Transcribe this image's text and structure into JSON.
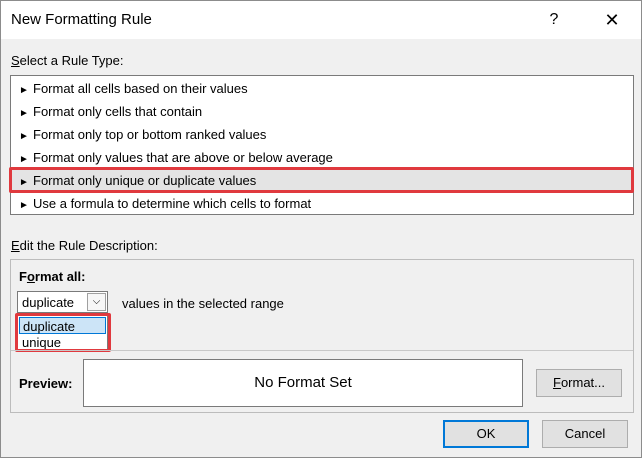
{
  "dialog": {
    "title": "New Formatting Rule",
    "help_label": "?",
    "close_label": "✕"
  },
  "rule_type": {
    "label_accel": "S",
    "label_rest": "elect a Rule Type:",
    "items": [
      "Format all cells based on their values",
      "Format only cells that contain",
      "Format only top or bottom ranked values",
      "Format only values that are above or below average",
      "Format only unique or duplicate values",
      "Use a formula to determine which cells to format"
    ],
    "selected_index": 4,
    "arrow_glyph": "►"
  },
  "description": {
    "label_accel": "E",
    "label_rest": "dit the Rule Description:",
    "format_all_accel": "o",
    "format_all_pre": "F",
    "format_all_post": "rmat all:",
    "combo_value": "duplicate",
    "combo_suffix": "values in the selected range",
    "options": [
      "duplicate",
      "unique"
    ],
    "highlight_color": "#e0393e"
  },
  "preview": {
    "label": "Preview:",
    "text": "No Format Set",
    "format_button_accel": "F",
    "format_button_rest": "ormat..."
  },
  "footer": {
    "ok_label": "OK",
    "cancel_label": "Cancel"
  }
}
